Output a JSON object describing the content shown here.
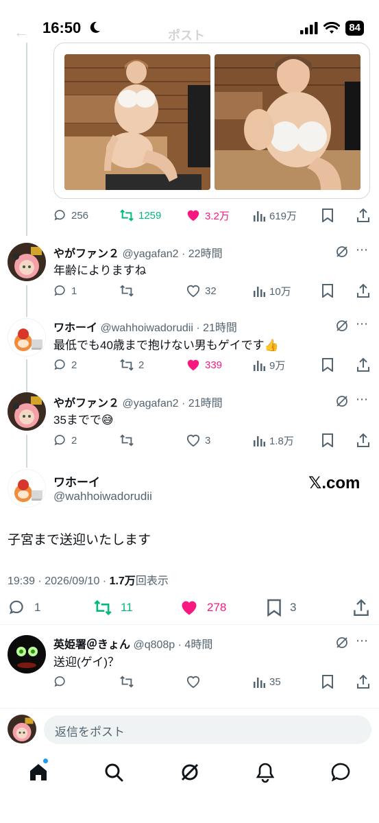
{
  "status_bar": {
    "time": "16:50",
    "battery": "84"
  },
  "header": {
    "title": "ポスト"
  },
  "media_post": {
    "stats": {
      "replies": "256",
      "reposts": "1259",
      "likes": "3.2万",
      "views": "619万"
    }
  },
  "replies": [
    {
      "name": "やがファン２",
      "handle": "@yagafan2",
      "time": "22時間",
      "text": "年齢によりますね",
      "stats": {
        "replies": "1",
        "reposts": "",
        "likes": "32",
        "views": "10万"
      }
    },
    {
      "name": "ワホーイ",
      "handle": "@wahhoiwadorudii",
      "time": "21時間",
      "text": "最低でも40歳まで抱けない男もゲイです",
      "stats": {
        "replies": "2",
        "reposts": "2",
        "likes": "339",
        "views": "9万"
      }
    },
    {
      "name": "やがファン２",
      "handle": "@yagafan2",
      "time": "21時間",
      "text": "35までで",
      "stats": {
        "replies": "2",
        "reposts": "",
        "likes": "3",
        "views": "1.8万"
      }
    }
  ],
  "main_post": {
    "name": "ワホーイ",
    "handle": "@wahhoiwadorudii",
    "source_label": "𝕏.com",
    "text": "子宮まで送迎いたします",
    "timestamp": "19:39 · 2026/09/10 · ",
    "view_count": "1.7万",
    "view_label": "回表示",
    "stats": {
      "replies": "1",
      "reposts": "11",
      "likes": "278",
      "bookmarks": "3"
    }
  },
  "bottom_reply": {
    "name": "英姫署＠きょん",
    "handle": "@q808p",
    "time": "4時間",
    "text": "送迎(ゲイ)？",
    "stats": {
      "views": "35"
    }
  },
  "compose": {
    "placeholder": "返信をポスト"
  },
  "icons": {
    "reply": "speech-bubble-icon",
    "repost": "repost-arrows-icon",
    "like": "heart-icon",
    "views": "bar-chart-icon",
    "bookmark": "bookmark-icon",
    "share": "share-upload-icon",
    "grok": "grok-icon",
    "more": "more-dots-icon"
  },
  "colors": {
    "accent": "#1d9bf0",
    "like": "#f91880",
    "repost": "#00ba7c",
    "muted": "#536471"
  }
}
